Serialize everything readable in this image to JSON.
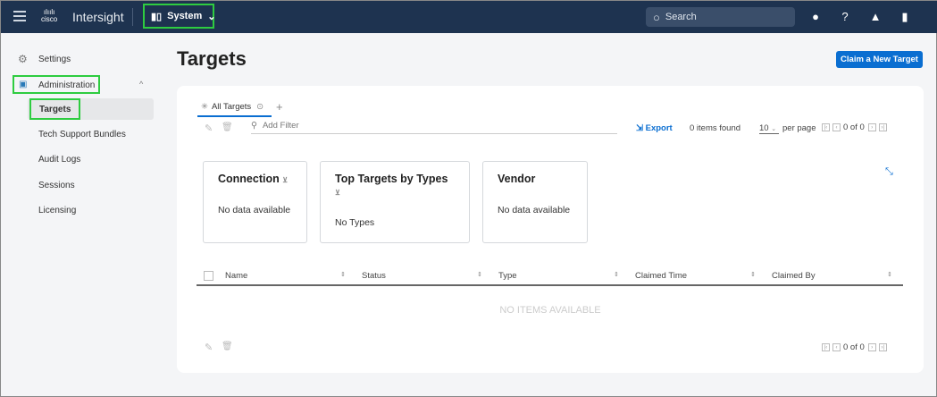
{
  "header": {
    "brand": "Intersight",
    "logo": "cisco",
    "scope": "System",
    "search_placeholder": "Search"
  },
  "sidebar": {
    "items": [
      {
        "label": "Settings"
      },
      {
        "label": "Administration"
      }
    ],
    "sub_items": [
      "Targets",
      "Tech Support Bundles",
      "Audit Logs",
      "Sessions",
      "Licensing"
    ]
  },
  "page": {
    "title": "Targets",
    "claim_button": "Claim a New Target"
  },
  "tabs": {
    "active": "All Targets",
    "add": "+"
  },
  "toolbar": {
    "filter_placeholder": "Add Filter",
    "export": "Export",
    "items_found": "0 items found",
    "per_page_value": "10",
    "per_page": "per page",
    "page_info": "0 of 0"
  },
  "cards": [
    {
      "title": "Connection",
      "body": "No data available"
    },
    {
      "title": "Top Targets by Types",
      "body": "No Types"
    },
    {
      "title": "Vendor",
      "body": "No data available"
    }
  ],
  "table": {
    "columns": [
      "Name",
      "Status",
      "Type",
      "Claimed Time",
      "Claimed By"
    ],
    "empty": "NO ITEMS AVAILABLE",
    "page_info": "0 of 0"
  },
  "colors": {
    "header": "#1e3350",
    "accent": "#0a6ed1",
    "highlight": "#2ecc40"
  }
}
